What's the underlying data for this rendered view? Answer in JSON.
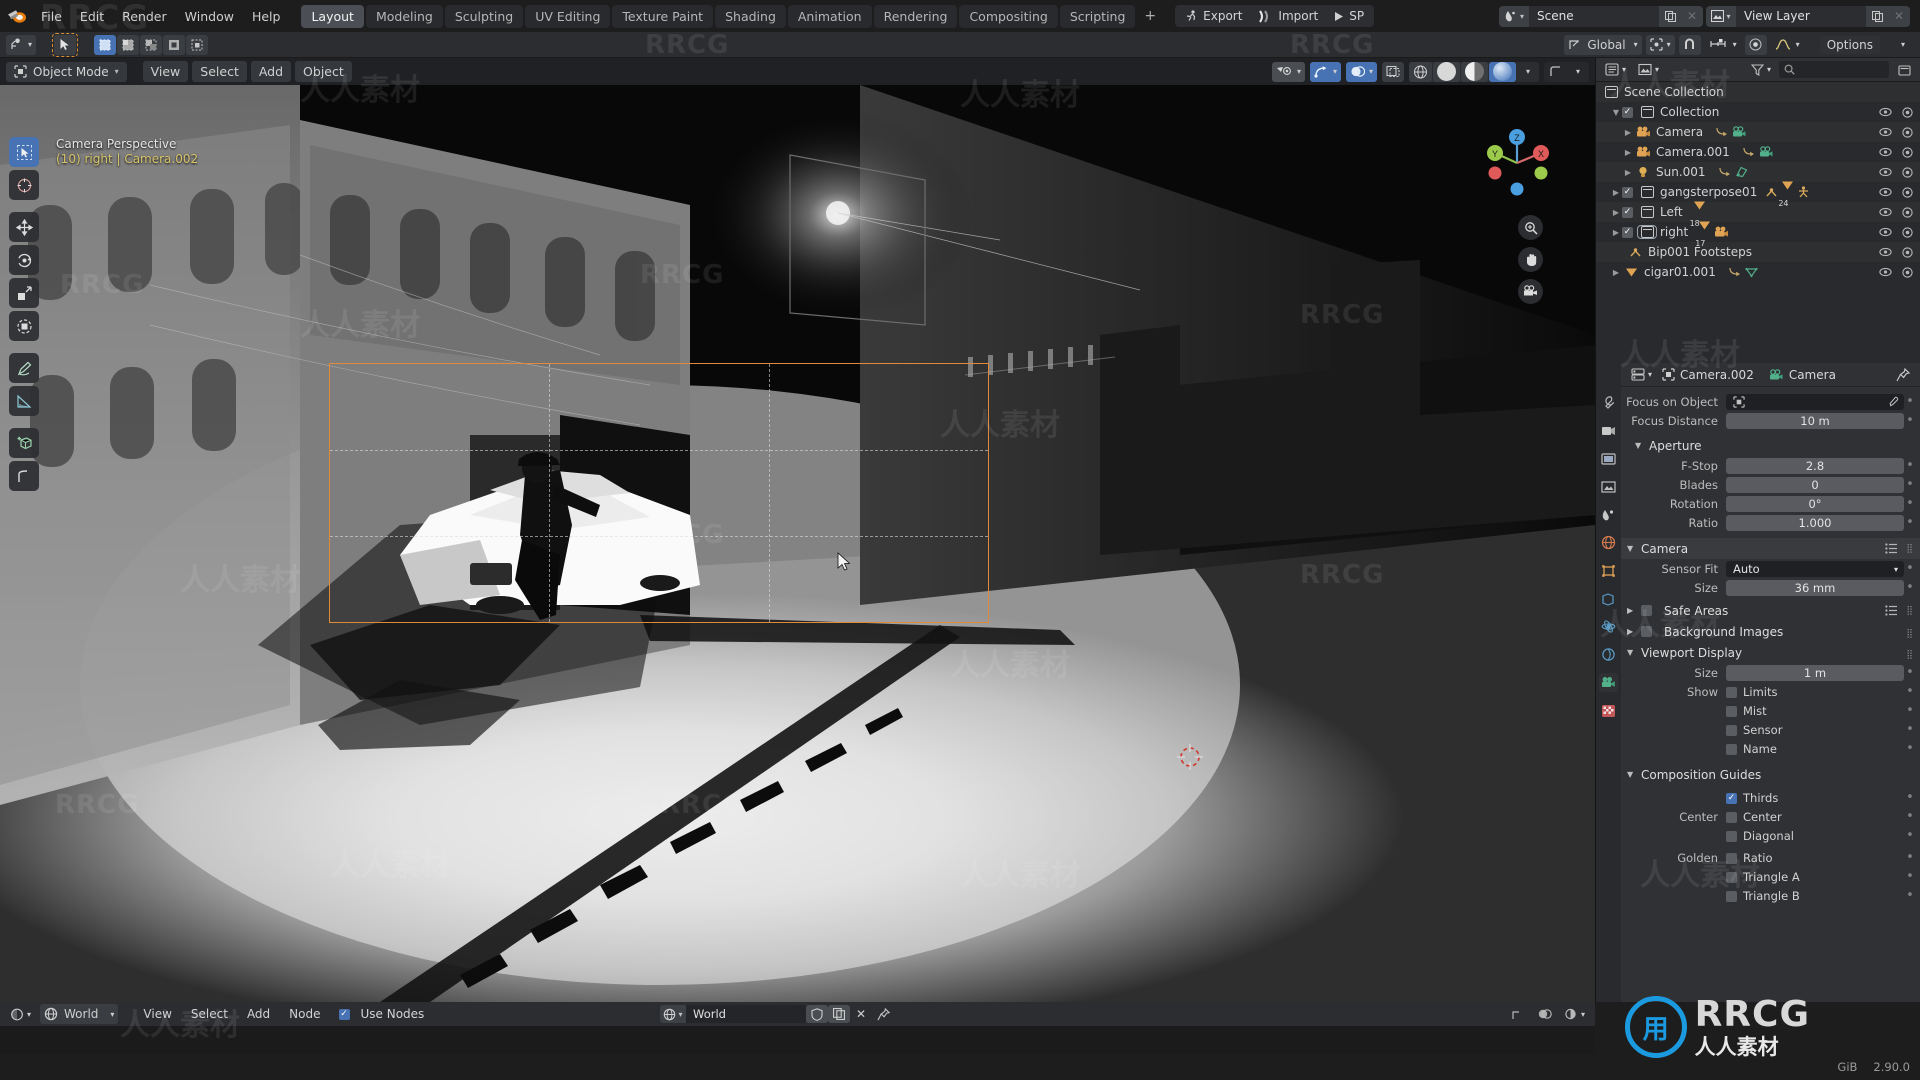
{
  "topbar": {
    "menus": [
      "File",
      "Edit",
      "Render",
      "Window",
      "Help"
    ],
    "workspaces": [
      {
        "label": "Layout",
        "active": true
      },
      {
        "label": "Modeling",
        "active": false
      },
      {
        "label": "Sculpting",
        "active": false
      },
      {
        "label": "UV Editing",
        "active": false
      },
      {
        "label": "Texture Paint",
        "active": false
      },
      {
        "label": "Shading",
        "active": false
      },
      {
        "label": "Animation",
        "active": false
      },
      {
        "label": "Rendering",
        "active": false
      },
      {
        "label": "Compositing",
        "active": false
      },
      {
        "label": "Scripting",
        "active": false
      }
    ],
    "workspace_add": "+",
    "addons": [
      {
        "label": "Export",
        "icon": "running-man-icon"
      },
      {
        "label": "Import",
        "icon": "import-arrow-icon"
      },
      {
        "label": "SP",
        "icon": "play-icon"
      }
    ],
    "scene": {
      "name": "Scene",
      "new_icon": "duplicate-icon",
      "unlink_icon": "close-icon"
    },
    "view_layer": {
      "name": "View Layer",
      "new_icon": "duplicate-icon",
      "unlink_icon": "close-icon"
    }
  },
  "toolrow": {
    "cursor_label": "cursor-tool",
    "select_modes": [
      "set",
      "extend",
      "subtract",
      "invert",
      "intersect"
    ],
    "transform_orientation": "Global",
    "pivot_icon": "pivot-point-icon",
    "snap_icon": "snap-magnet-icon",
    "proportional_icon": "proportional-edit-icon",
    "falloff_icon": "smooth-falloff-icon",
    "options_label": "Options"
  },
  "viewport": {
    "mode": "Object Mode",
    "menus": [
      "View",
      "Select",
      "Add",
      "Object"
    ],
    "overlay": {
      "line1": "Camera Perspective",
      "line2": "(10) right | Camera.002"
    },
    "tools": [
      {
        "name": "tweak-tool",
        "active": true
      },
      {
        "name": "cursor-tool",
        "active": false
      },
      {
        "name": "move-tool",
        "active": false
      },
      {
        "name": "rotate-tool",
        "active": false
      },
      {
        "name": "scale-tool",
        "active": false
      },
      {
        "name": "transform-tool",
        "active": false
      },
      {
        "name": "annotate-tool",
        "active": false
      },
      {
        "name": "measure-tool",
        "active": false
      },
      {
        "name": "add-cube-tool",
        "active": false
      },
      {
        "name": "extra-tool",
        "active": false
      }
    ],
    "shading_modes": [
      "wireframe",
      "solid",
      "material-preview",
      "rendered"
    ],
    "active_shading": "rendered",
    "gizmo_axes": [
      "X",
      "Y",
      "Z"
    ],
    "nav_buttons": [
      "zoom-icon",
      "pan-hand-icon",
      "camera-view-icon"
    ]
  },
  "outliner": {
    "display_mode": "View Layer",
    "search_placeholder": "",
    "rows": [
      {
        "label": "Scene Collection",
        "indent": 0,
        "icon": "collection-icon",
        "checkbox": false,
        "disclosure": "",
        "badges": [],
        "selected": false
      },
      {
        "label": "Collection",
        "indent": 1,
        "icon": "collection-icon",
        "checkbox": true,
        "disclosure": "down",
        "badges": [],
        "selected": false
      },
      {
        "label": "Camera",
        "indent": 2,
        "icon": "camera-object-icon",
        "checkbox": false,
        "disclosure": "right",
        "badges": [
          "camera-data-icon"
        ],
        "selected": false
      },
      {
        "label": "Camera.001",
        "indent": 2,
        "icon": "camera-object-icon",
        "checkbox": false,
        "disclosure": "right",
        "badges": [
          "camera-data-icon"
        ],
        "selected": false
      },
      {
        "label": "Sun.001",
        "indent": 2,
        "icon": "light-object-icon",
        "checkbox": false,
        "disclosure": "right",
        "badges": [
          "light-data-icon"
        ],
        "selected": false
      },
      {
        "label": "gangsterpose01",
        "indent": 1,
        "icon": "collection-icon",
        "checkbox": true,
        "disclosure": "right",
        "badges": [
          "armature-icon",
          "mesh-icon",
          "pose-icon"
        ],
        "count": "24",
        "selected": false
      },
      {
        "label": "Left",
        "indent": 1,
        "icon": "collection-icon",
        "checkbox": true,
        "disclosure": "right",
        "badges": [
          "mesh-icon"
        ],
        "count": "18",
        "selected": false
      },
      {
        "label": "right",
        "indent": 1,
        "icon": "collection-icon",
        "checkbox": true,
        "disclosure": "right",
        "badges": [
          "mesh-icon",
          "camera-data-icon"
        ],
        "count": "17",
        "selected": true
      },
      {
        "label": "Bip001 Footsteps",
        "indent": 2,
        "icon": "armature-icon",
        "checkbox": false,
        "disclosure": "",
        "badges": [],
        "selected": false
      },
      {
        "label": "cigar01.001",
        "indent": 1,
        "icon": "mesh-icon",
        "checkbox": false,
        "disclosure": "right",
        "badges": [
          "mesh-data-icon"
        ],
        "selected": false
      }
    ]
  },
  "properties": {
    "breadcrumb": {
      "object": "Camera.002",
      "data": "Camera"
    },
    "tabs": [
      "tool-icon",
      "render-icon",
      "output-icon",
      "view-layer-icon",
      "scene-icon",
      "world-icon",
      "object-icon",
      "modifiers-icon",
      "physics-icon",
      "constraints-icon",
      "data-icon",
      "material-icon"
    ],
    "active_tab_index": 10,
    "depth_of_field": {
      "focus_on_object_label": "Focus on Object",
      "focus_on_object_value": "",
      "focus_distance_label": "Focus Distance",
      "focus_distance_value": "10 m"
    },
    "aperture": {
      "title": "Aperture",
      "rows": [
        {
          "label": "F-Stop",
          "value": "2.8"
        },
        {
          "label": "Blades",
          "value": "0"
        },
        {
          "label": "Rotation",
          "value": "0°"
        },
        {
          "label": "Ratio",
          "value": "1.000"
        }
      ]
    },
    "camera": {
      "title": "Camera",
      "sensor_fit_label": "Sensor Fit",
      "sensor_fit_value": "Auto",
      "size_label": "Size",
      "size_value": "36 mm"
    },
    "safe_areas": {
      "title": "Safe Areas",
      "checked": false
    },
    "background_images": {
      "title": "Background Images",
      "checked": false
    },
    "viewport_display": {
      "title": "Viewport Display",
      "size_label": "Size",
      "size_value": "1 m",
      "show_label": "Show",
      "show_items": [
        {
          "label": "Limits",
          "checked": false
        },
        {
          "label": "Mist",
          "checked": false
        },
        {
          "label": "Sensor",
          "checked": false
        },
        {
          "label": "Name",
          "checked": false
        }
      ]
    },
    "composition_guides": {
      "title": "Composition Guides",
      "items": [
        {
          "group": "",
          "label": "Thirds",
          "checked": true
        },
        {
          "group": "Center",
          "label": "Center",
          "checked": false
        },
        {
          "group": "",
          "label": "Diagonal",
          "checked": false
        },
        {
          "group": "Golden",
          "label": "Ratio",
          "checked": false
        },
        {
          "group": "",
          "label": "Triangle A",
          "checked": false
        },
        {
          "group": "",
          "label": "Triangle B",
          "checked": false
        }
      ]
    }
  },
  "bottom_editor": {
    "editor_type": "shader-editor-icon",
    "shader_type": "World",
    "menus": [
      "View",
      "Select",
      "Add",
      "Node"
    ],
    "use_nodes_label": "Use Nodes",
    "use_nodes_checked": true,
    "world_id": "World",
    "fake_user_icon": "shield-icon",
    "new_icon": "duplicate-icon",
    "unlink_icon": "close-icon",
    "pin_icon": "pin-icon"
  },
  "status_bar": {
    "memory": "GiB",
    "version": "2.90.0"
  },
  "watermarks": {
    "cn": "人人素材",
    "rr": "RRCG",
    "logo_top": "RRCG",
    "logo_bottom": "人人素材"
  },
  "colors": {
    "accent_blue": "#4772b3",
    "camera_frame": "#e08a3c",
    "logo_blue": "#1b9ae0",
    "overlay_yellow": "#d8c56a"
  }
}
